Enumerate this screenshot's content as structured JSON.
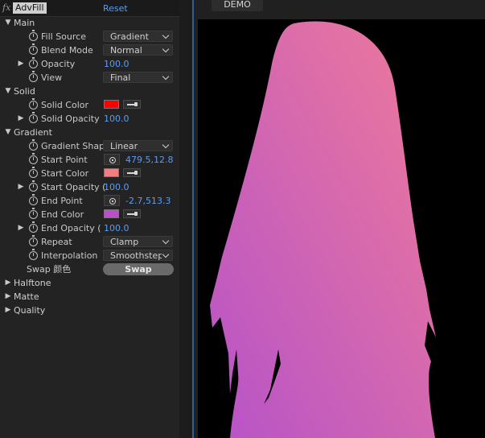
{
  "header": {
    "fx_label": "fx",
    "effect_name": "AdvFill",
    "reset_label": "Reset"
  },
  "sections": {
    "main": "Main",
    "solid": "Solid",
    "gradient": "Gradient",
    "halftone": "Halftone",
    "matte": "Matte",
    "quality": "Quality"
  },
  "main": {
    "fill_source": {
      "label": "Fill Source",
      "value": "Gradient"
    },
    "blend_mode": {
      "label": "Blend Mode",
      "value": "Normal"
    },
    "opacity": {
      "label": "Opacity",
      "value": "100.0"
    },
    "view": {
      "label": "View",
      "value": "Final"
    }
  },
  "solid": {
    "color": {
      "label": "Solid Color",
      "value": "#ff0000"
    },
    "opacity": {
      "label": "Solid Opacity",
      "value": "100.0"
    }
  },
  "gradient": {
    "shape": {
      "label": "Gradient Shap",
      "value": "Linear"
    },
    "start_point": {
      "label": "Start Point",
      "value": "479.5,12.8"
    },
    "start_color": {
      "label": "Start Color",
      "value": "#f08080"
    },
    "start_opacity": {
      "label": "Start Opacity (",
      "value": "100.0"
    },
    "end_point": {
      "label": "End Point",
      "value": "-2.7,513.3"
    },
    "end_color": {
      "label": "End Color",
      "value": "#b94fc9"
    },
    "end_opacity": {
      "label": "End Opacity (",
      "value": "100.0"
    },
    "repeat": {
      "label": "Repeat",
      "value": "Clamp"
    },
    "interpolation": {
      "label": "Interpolation",
      "value": "Smoothstep"
    },
    "swap": {
      "label": "Swap 颜色",
      "button": "Swap"
    }
  },
  "viewer": {
    "tab_label": "DEMO",
    "gradient_start": "#ef7a9a",
    "gradient_end": "#b653c8"
  },
  "icons": {
    "stopwatch": "stopwatch-icon",
    "eyedropper": "eyedropper-icon",
    "point": "crosshair-icon"
  }
}
